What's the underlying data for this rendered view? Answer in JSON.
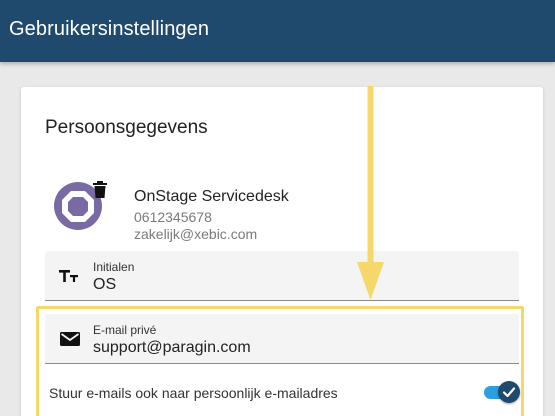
{
  "app": {
    "title": "Gebruikersinstellingen"
  },
  "card": {
    "section_title": "Persoonsgegevens",
    "profile": {
      "name": "OnStage Servicedesk",
      "phone": "0612345678",
      "email": "zakelijk@xebic.com",
      "avatar_icon": "octagon-avatar-icon",
      "delete_icon": "trash-icon"
    },
    "fields": {
      "initials": {
        "icon": "text-size-icon",
        "label": "Initialen",
        "value": "OS"
      },
      "private_email": {
        "icon": "envelope-icon",
        "label": "E-mail privé",
        "value": "support@paragin.com"
      }
    },
    "forward_toggle": {
      "label": "Stuur e-mails ook naar persoonlijk e-mailadres",
      "checked": true
    }
  },
  "colors": {
    "header": "#1f4a6e",
    "avatar": "#7a6aa3",
    "toggle_track": "#2d9ee0",
    "highlight": "#f6d86a"
  }
}
